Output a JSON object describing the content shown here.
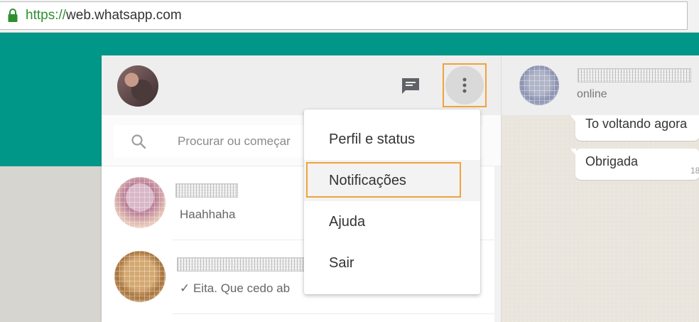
{
  "browser": {
    "url_scheme": "https://",
    "url_rest": "web.whatsapp.com"
  },
  "left_header": {
    "icons": [
      "avatar",
      "chat-icon",
      "menu-dots-icon"
    ]
  },
  "search": {
    "placeholder": "Procurar ou começar"
  },
  "chats": [
    {
      "preview": "Haahhaha"
    },
    {
      "preview": "✓ Eita. Que cedo ab"
    }
  ],
  "contact": {
    "status": "online"
  },
  "messages": [
    {
      "text": "To voltando agora"
    },
    {
      "text": "Obrigada",
      "time": "18"
    }
  ],
  "menu": {
    "items": [
      {
        "label": "Perfil e status"
      },
      {
        "label": "Notificações",
        "highlighted": true
      },
      {
        "label": "Ajuda"
      },
      {
        "label": "Sair"
      }
    ]
  },
  "colors": {
    "brand_teal": "#009788",
    "highlight_orange": "#f0a33c",
    "url_green": "#2f8f2f"
  }
}
